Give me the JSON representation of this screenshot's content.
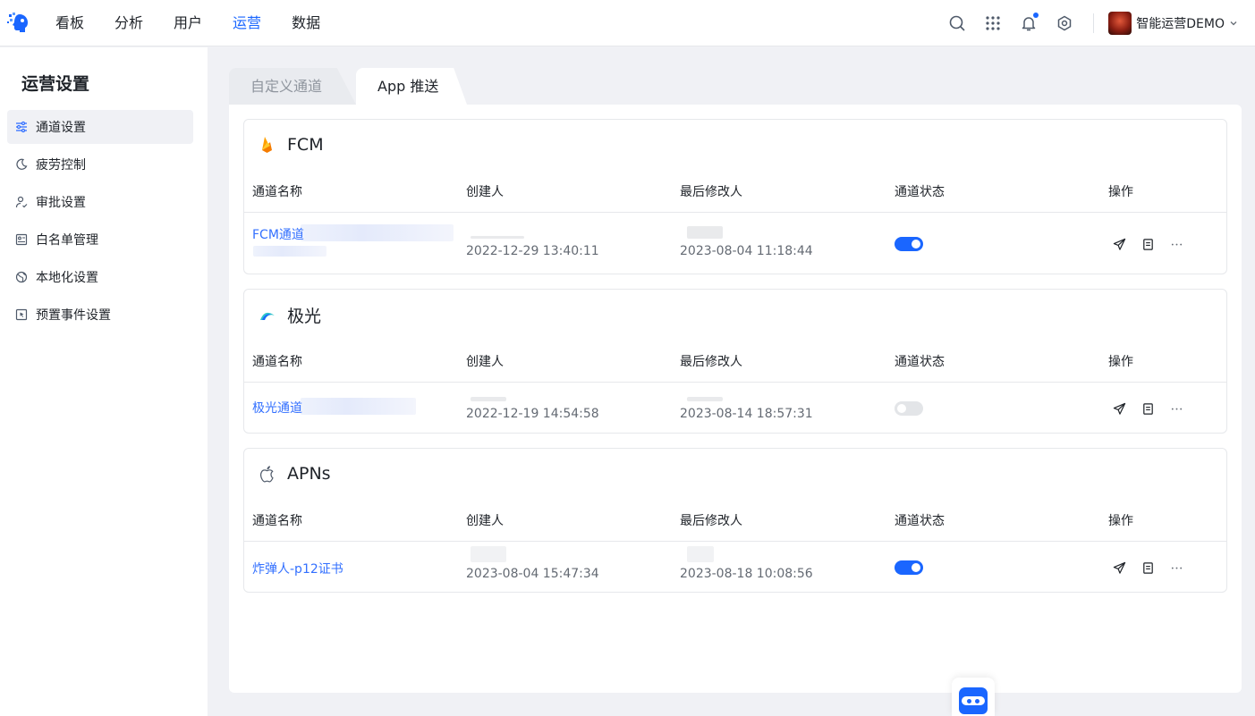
{
  "nav": {
    "items": [
      "看板",
      "分析",
      "用户",
      "运营",
      "数据"
    ],
    "active_index": 3
  },
  "user": {
    "name": "智能运营DEMO"
  },
  "icons": {
    "search": "search-icon",
    "apps": "grid-icon",
    "notify": "bell-icon",
    "settings": "gear-icon"
  },
  "colors": {
    "accent": "#1a66ff",
    "link": "#3370ff",
    "switch_off": "#e3e5e8"
  },
  "sidebar": {
    "title": "运营设置",
    "items": [
      {
        "label": "通道设置",
        "icon": "sliders-icon",
        "active": true
      },
      {
        "label": "疲劳控制",
        "icon": "moon-icon",
        "active": false
      },
      {
        "label": "审批设置",
        "icon": "user-check-icon",
        "active": false
      },
      {
        "label": "白名单管理",
        "icon": "id-card-icon",
        "active": false
      },
      {
        "label": "本地化设置",
        "icon": "globe-icon",
        "active": false
      },
      {
        "label": "预置事件设置",
        "icon": "event-icon",
        "active": false
      }
    ]
  },
  "tabs": [
    {
      "label": "自定义通道",
      "active": false
    },
    {
      "label": "App 推送",
      "active": true
    }
  ],
  "columns": [
    "通道名称",
    "创建人",
    "最后修改人",
    "通道状态",
    "操作"
  ],
  "cards": [
    {
      "title": "FCM",
      "icon": "firebase-icon",
      "rows": [
        {
          "name": "FCM通道",
          "created": "2022-12-29 13:40:11",
          "modified": "2023-08-04 11:18:44",
          "enabled": true
        }
      ]
    },
    {
      "title": "极光",
      "icon": "jiguang-icon",
      "rows": [
        {
          "name": "极光通道",
          "created": "2022-12-19 14:54:58",
          "modified": "2023-08-14 18:57:31",
          "enabled": false
        }
      ]
    },
    {
      "title": "APNs",
      "icon": "apple-icon",
      "rows": [
        {
          "name": "炸弹人-p12证书",
          "created": "2023-08-04 15:47:34",
          "modified": "2023-08-18 10:08:56",
          "enabled": true
        }
      ]
    }
  ]
}
